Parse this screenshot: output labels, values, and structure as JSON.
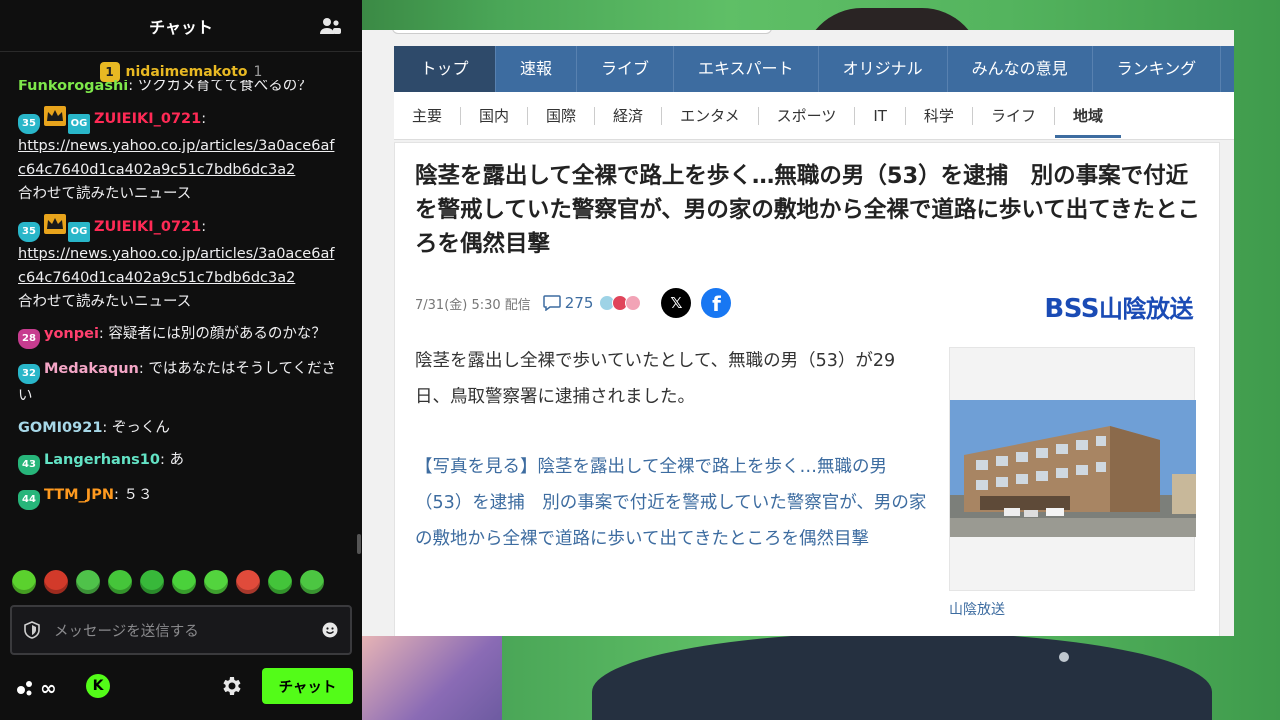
{
  "chat": {
    "title": "チャット",
    "viewer_badge": "1",
    "viewer_name": "nidaimemakoto",
    "viewer_count": "1",
    "messages": [
      {
        "user": "Funkorogashi",
        "text": "ツクガメ育てて食べるの？",
        "user_color": "#7ee84b",
        "cut": true
      },
      {
        "level": "35",
        "level_color": "#29b6c9",
        "crown": true,
        "og": "OG",
        "user": "ZUIEIKI_0721",
        "user_color": "#ff2a55",
        "link": "https://news.yahoo.co.jp/articles/3a0ace6afc64c7640d1ca402a9c51c7bdb6dc3a2",
        "text": "合わせて読みたいニュース"
      },
      {
        "level": "35",
        "level_color": "#29b6c9",
        "crown": true,
        "og": "OG",
        "user": "ZUIEIKI_0721",
        "user_color": "#ff2a55",
        "link": "https://news.yahoo.co.jp/articles/3a0ace6afc64c7640d1ca402a9c51c7bdb6dc3a2",
        "text": "合わせて読みたいニュース"
      },
      {
        "level": "28",
        "level_color": "#c73c8f",
        "user": "yonpei",
        "user_color": "#ff3f6e",
        "text": "容疑者には別の顔があるのかな？"
      },
      {
        "level": "32",
        "level_color": "#29b6c9",
        "user": "Medakaqun",
        "user_color": "#f4a6c6",
        "text": "ではあなたはそうしてください"
      },
      {
        "user": "GOMI0921",
        "user_color": "#a7d8e8",
        "text": "ぞっくん"
      },
      {
        "level": "43",
        "level_color": "#27b57a",
        "user": "Langerhans10",
        "user_color": "#63e3c5",
        "text": "あ"
      },
      {
        "level": "44",
        "level_color": "#27b57a",
        "user": "TTM_JPN",
        "user_color": "#ff9a1f",
        "text": "５３"
      }
    ],
    "emotes": [
      "angel-emote",
      "angry-emote",
      "eyes-emote",
      "grin-emote",
      "headphones-emote",
      "smile-emote",
      "wave-emote",
      "hat-emote",
      "cry-emote",
      "love-emote"
    ],
    "input_placeholder": "メッセージを送信する",
    "points_label": "∞",
    "kick_label": "K",
    "send_label": "チャット"
  },
  "browser": {
    "top_nav": [
      "トップ",
      "速報",
      "ライブ",
      "エキスパート",
      "オリジナル",
      "みんなの意見",
      "ランキング"
    ],
    "top_nav_active": 0,
    "sub_nav": [
      "主要",
      "国内",
      "国際",
      "経済",
      "エンタメ",
      "スポーツ",
      "IT",
      "科学",
      "ライフ",
      "地域"
    ],
    "sub_nav_active": 9,
    "headline": "陰茎を露出して全裸で路上を歩く…無職の男（53）を逮捕　別の事案で付近を警戒していた警察官が、男の家の敷地から全裸で道路に歩いて出てきたところを偶然目撃",
    "pub_date": "7/31(金) 5:30 配信",
    "comment_count": "275",
    "source_logo_bss": "BSS",
    "source_logo_text": "山陰放送",
    "body": "陰茎を露出し全裸で歩いていたとして、無職の男（53）が29日、鳥取警察署に逮捕されました。",
    "photo_link": "【写真を見る】陰茎を露出して全裸で路上を歩く…無職の男（53）を逮捕　別の事案で付近を警戒していた警察官が、男の家の敷地から全裸で道路に歩いて出てきたところを偶然目撃",
    "photo_caption": "山陰放送"
  },
  "colors": {
    "kick_green": "#53fc18",
    "yahoo_nav": "#3d6ca0",
    "chroma_green": "#5fbf66"
  }
}
